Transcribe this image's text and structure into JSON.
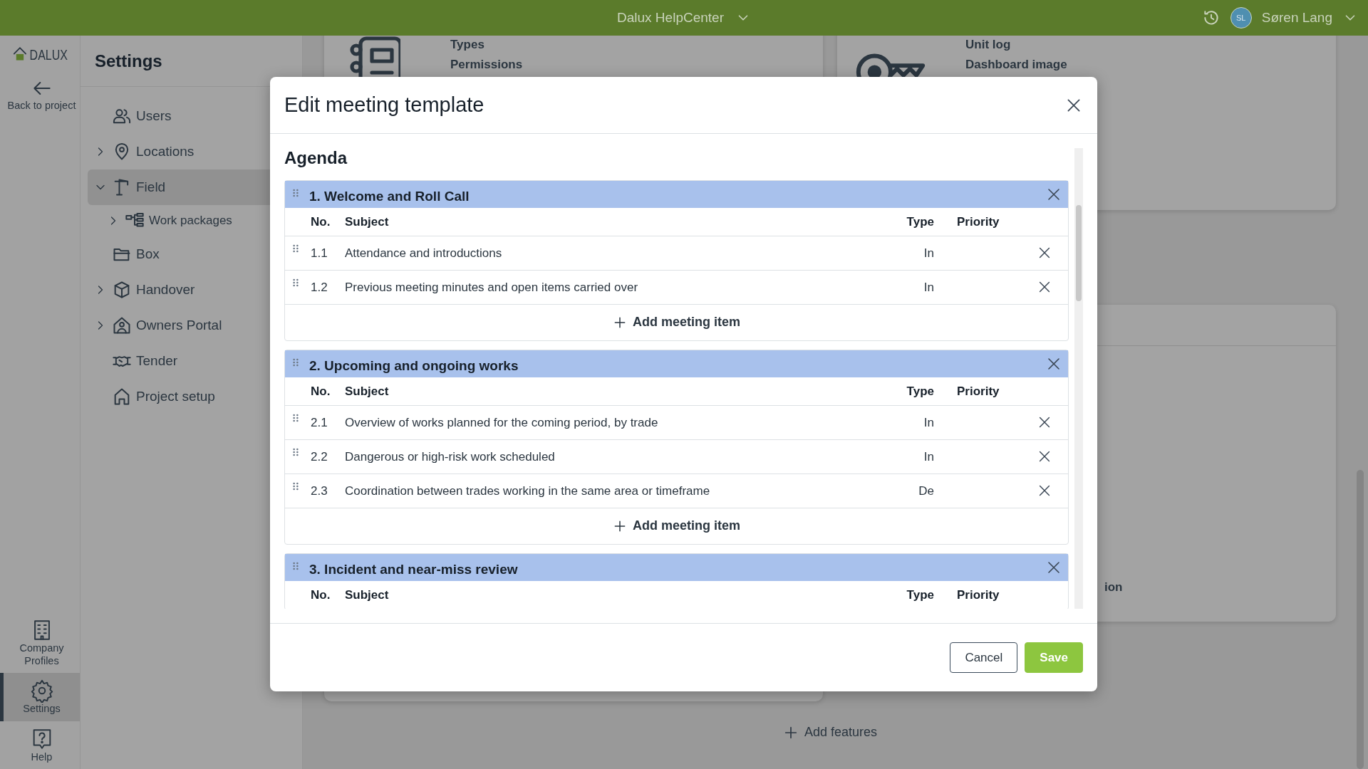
{
  "top_bar": {
    "title": "Dalux HelpCenter",
    "user_initials": "SL",
    "user_name": "Søren Lang"
  },
  "rail": {
    "logo": "DALUX",
    "back": "Back to project",
    "items": [
      {
        "label": "Company Profiles",
        "selected": false
      },
      {
        "label": "Settings",
        "selected": true
      },
      {
        "label": "Help",
        "selected": false
      }
    ]
  },
  "sidebar": {
    "title": "Settings",
    "items": [
      {
        "label": "Users",
        "expandable": false,
        "selected": false
      },
      {
        "label": "Locations",
        "expandable": true,
        "expanded": false,
        "selected": false
      },
      {
        "label": "Field",
        "expandable": true,
        "expanded": true,
        "selected": true,
        "children": [
          {
            "label": "Work packages",
            "expandable": true,
            "expanded": false,
            "selected": false
          }
        ]
      },
      {
        "label": "Box",
        "expandable": false,
        "selected": false
      },
      {
        "label": "Handover",
        "expandable": true,
        "expanded": false,
        "selected": false
      },
      {
        "label": "Owners Portal",
        "expandable": true,
        "expanded": false,
        "selected": false
      },
      {
        "label": "Tender",
        "expandable": false,
        "selected": false
      },
      {
        "label": "Project setup",
        "expandable": false,
        "selected": false
      }
    ]
  },
  "background": {
    "cards": [
      {
        "lines": [
          "Types",
          "Permissions"
        ]
      },
      {
        "lines": [
          "Unit log",
          "Dashboard image"
        ]
      },
      {
        "lines": [
          "ion"
        ]
      }
    ],
    "add_features": "Add features"
  },
  "modal": {
    "title": "Edit meeting template",
    "heading": "Agenda",
    "sections": [
      {
        "title": "1. Welcome and Roll Call",
        "columns": [
          "No.",
          "Subject",
          "Type",
          "Priority"
        ],
        "items": [
          {
            "no": "1.1",
            "subject": "Attendance and introductions",
            "type": "In"
          },
          {
            "no": "1.2",
            "subject": "Previous meeting minutes and open items carried over",
            "type": "In"
          }
        ],
        "add_label": "Add meeting item"
      },
      {
        "title": "2. Upcoming and ongoing works",
        "columns": [
          "No.",
          "Subject",
          "Type",
          "Priority"
        ],
        "items": [
          {
            "no": "2.1",
            "subject": "Overview of works planned for the coming period, by trade",
            "type": "In"
          },
          {
            "no": "2.2",
            "subject": "Dangerous or high-risk work scheduled",
            "type": "In"
          },
          {
            "no": "2.3",
            "subject": "Coordination between trades working in the same area or timeframe",
            "type": "De"
          }
        ],
        "add_label": "Add meeting item"
      },
      {
        "title": "3. Incident and near-miss review",
        "columns": [
          "No.",
          "Subject",
          "Type",
          "Priority"
        ]
      }
    ],
    "buttons": [
      {
        "label": "Cancel",
        "kind": "secondary"
      },
      {
        "label": "Save",
        "kind": "primary"
      }
    ]
  }
}
